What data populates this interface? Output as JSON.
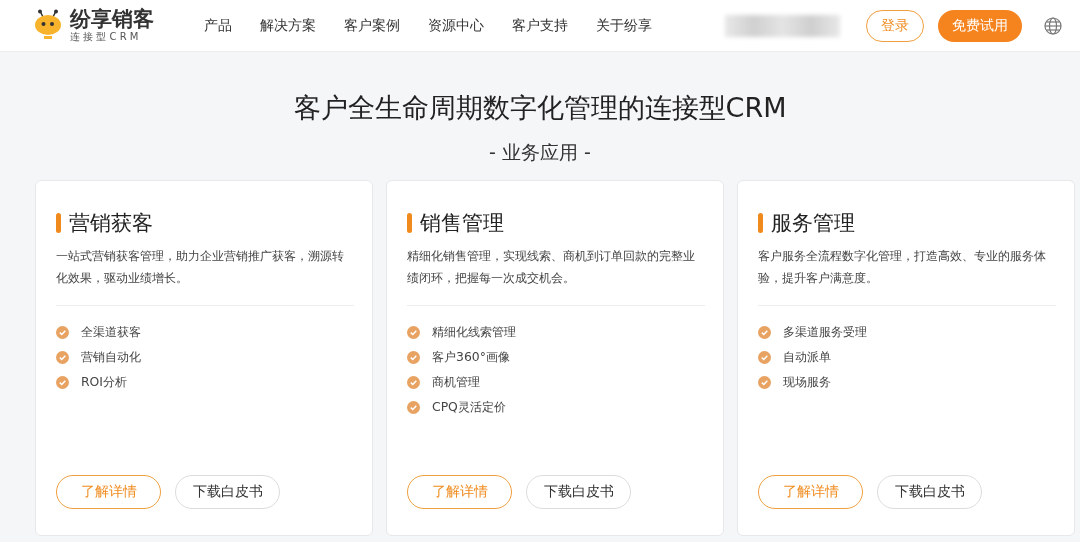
{
  "header": {
    "logo": {
      "name": "纷享销客",
      "tagline": "连 接 型 C R M"
    },
    "nav": [
      "产品",
      "解决方案",
      "客户案例",
      "资源中心",
      "客户支持",
      "关于纷享"
    ],
    "login_button": "登录",
    "trial_button": "免费试用"
  },
  "hero": {
    "title": "客户全生命周期数字化管理的连接型CRM",
    "subtitle": "- 业务应用 -"
  },
  "cards": [
    {
      "title": "营销获客",
      "description": "一站式营销获客管理，助力企业营销推广获客，溯源转化效果，驱动业绩增长。",
      "features": [
        "全渠道获客",
        "营销自动化",
        "ROI分析"
      ],
      "buttons": [
        "了解详情",
        "下载白皮书"
      ]
    },
    {
      "title": "销售管理",
      "description": "精细化销售管理，实现线索、商机到订单回款的完整业绩闭环，把握每一次成交机会。",
      "features": [
        "精细化线索管理",
        "客户360°画像",
        "商机管理",
        "CPQ灵活定价"
      ],
      "buttons": [
        "了解详情",
        "下载白皮书"
      ]
    },
    {
      "title": "服务管理",
      "description": "客户服务全流程数字化管理，打造高效、专业的服务体验，提升客户满意度。",
      "features": [
        "多渠道服务受理",
        "自动派单",
        "现场服务"
      ],
      "buttons": [
        "了解详情",
        "下载白皮书"
      ]
    }
  ]
}
